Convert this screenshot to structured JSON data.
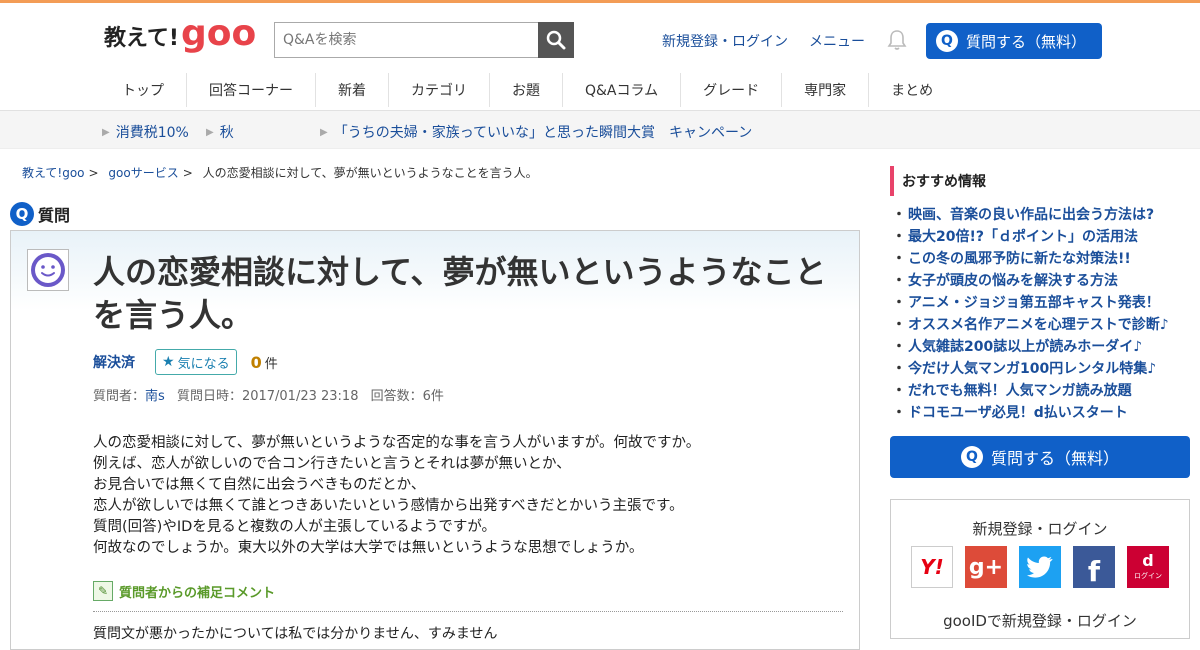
{
  "header": {
    "logo_text": "教えて!",
    "logo_brand": "goo",
    "search_placeholder": "Q&Aを検索",
    "register_login": "新規登録・ログイン",
    "menu": "メニュー",
    "ask_button": "質問する（無料）",
    "ask_icon_letter": "Q"
  },
  "nav": [
    "トップ",
    "回答コーナー",
    "新着",
    "カテゴリ",
    "お題",
    "Q&Aコラム",
    "グレード",
    "専門家",
    "まとめ"
  ],
  "subbar": {
    "items": [
      "消費税10%",
      "秋",
      "「うちの夫婦・家族っていいな」と思った瞬間大賞　キャンペーン"
    ]
  },
  "breadcrumb": {
    "items": [
      "教えて!goo",
      "gooサービス"
    ],
    "separator": ">",
    "current": "人の恋愛相談に対して、夢が無いというようなことを言う人。"
  },
  "question": {
    "section_label": "質問",
    "title": "人の恋愛相談に対して、夢が無いというようなことを言う人。",
    "status": "解決済",
    "kininaru_label": "気になる",
    "kininaru_count": "0",
    "count_unit": "件",
    "meta": {
      "asker_label": "質問者：",
      "asker_name": "南s",
      "date_label": "質問日時：2017/01/23 23:18",
      "answers_label": "回答数：6件"
    },
    "body": [
      "人の恋愛相談に対して、夢が無いというような否定的な事を言う人がいますが。何故ですか。",
      "例えば、恋人が欲しいので合コン行きたいと言うとそれは夢が無いとか、",
      "お見合いでは無くて自然に出会うべきものだとか、",
      "恋人が欲しいでは無くて誰とつきあいたいという感情から出発すべきだとかいう主張です。",
      "質問(回答)やIDを見ると複数の人が主張しているようですが。",
      "何故なのでしょうか。東大以外の大学は大学では無いというような思想でしょうか。"
    ],
    "supplement_label": "質問者からの補足コメント",
    "supplement_text": "質問文が悪かったかについては私では分かりません、すみません"
  },
  "sidebar": {
    "recommend_title": "おすすめ情報",
    "recommendations": [
      "映画、音楽の良い作品に出会う方法は?",
      "最大20倍!?「ｄポイント」の活用法",
      "この冬の風邪予防に新たな対策法!!",
      "女子が頭皮の悩みを解決する方法",
      "アニメ・ジョジョ第五部キャスト発表！",
      "オススメ名作アニメを心理テストで診断♪",
      "人気雑誌200誌以上が読みホーダイ♪",
      "今だけ人気マンガ100円レンタル特集♪",
      "だれでも無料！人気マンガ読み放題",
      "ドコモユーザ必見！d払いスタート"
    ],
    "ask_button": "質問する（無料）",
    "login_title": "新規登録・ログイン",
    "social": [
      {
        "name": "yahoo",
        "label": "Y!",
        "color": "#ffffff",
        "text_color": "#e60012"
      },
      {
        "name": "google-plus",
        "label": "g+",
        "color": "#dd4b39",
        "text_color": "#ffffff"
      },
      {
        "name": "twitter",
        "label": "t",
        "color": "#1da1f2",
        "text_color": "#ffffff"
      },
      {
        "name": "facebook",
        "label": "f",
        "color": "#3b5998",
        "text_color": "#ffffff"
      },
      {
        "name": "docomo",
        "label": "d",
        "color": "#cc0033",
        "text_color": "#ffffff",
        "sub": "ログイン"
      }
    ],
    "gooid_login": "gooIDで新規登録・ログイン"
  },
  "colors": {
    "accent_blue": "#1060c8",
    "link_blue": "#1a4e9a",
    "top_stripe": "#f39c56",
    "brand_red": "#e8434a"
  }
}
